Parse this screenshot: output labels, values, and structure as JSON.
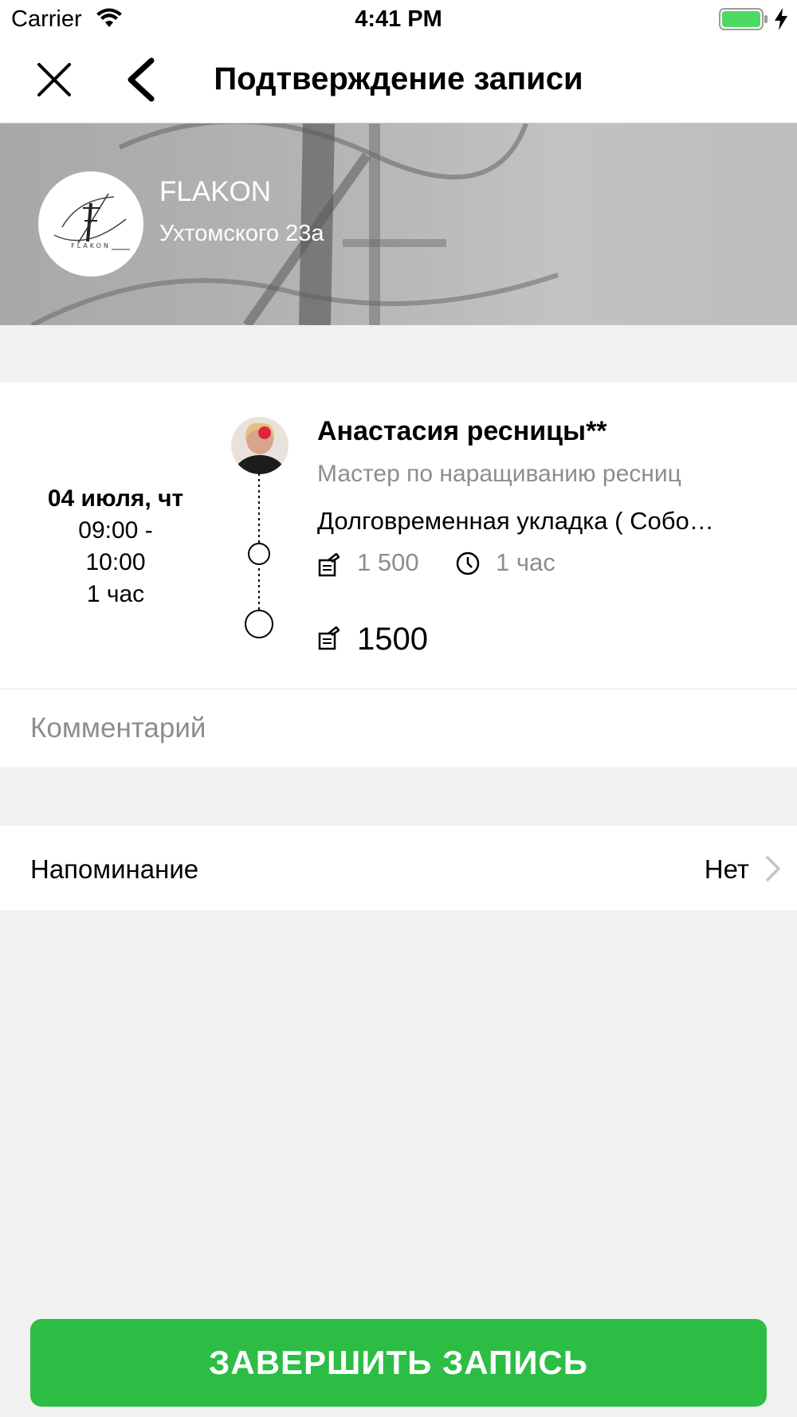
{
  "status_bar": {
    "carrier": "Carrier",
    "time": "4:41 PM",
    "icons": [
      "wifi-icon",
      "battery-icon",
      "charging-icon"
    ]
  },
  "nav": {
    "title": "Подтверждение записи",
    "icons": [
      "close-icon",
      "back-chevron-icon"
    ]
  },
  "salon": {
    "name": "FLAKON",
    "address": "Ухтомского 23а",
    "logo_text": "FLAKON"
  },
  "appointment": {
    "date": "04 июля, чт",
    "time_start": "09:00 -",
    "time_end": "10:00",
    "duration": "1 час",
    "master_name": "Анастасия ресницы**",
    "master_role": "Мастер по наращиванию ресниц",
    "service_name": "Долговременная укладка ( Собо…",
    "service_price": "1 500",
    "service_duration": "1 час",
    "total": "1500"
  },
  "comment": {
    "placeholder": "Комментарий",
    "value": ""
  },
  "reminder": {
    "label": "Напоминание",
    "value": "Нет"
  },
  "submit": {
    "label": "ЗАВЕРШИТЬ ЗАПИСЬ"
  },
  "colors": {
    "accent_green": "#2dbd44",
    "battery_green": "#4cd964",
    "secondary_text": "#8d8d8d",
    "page_background": "#f1f1f1"
  }
}
